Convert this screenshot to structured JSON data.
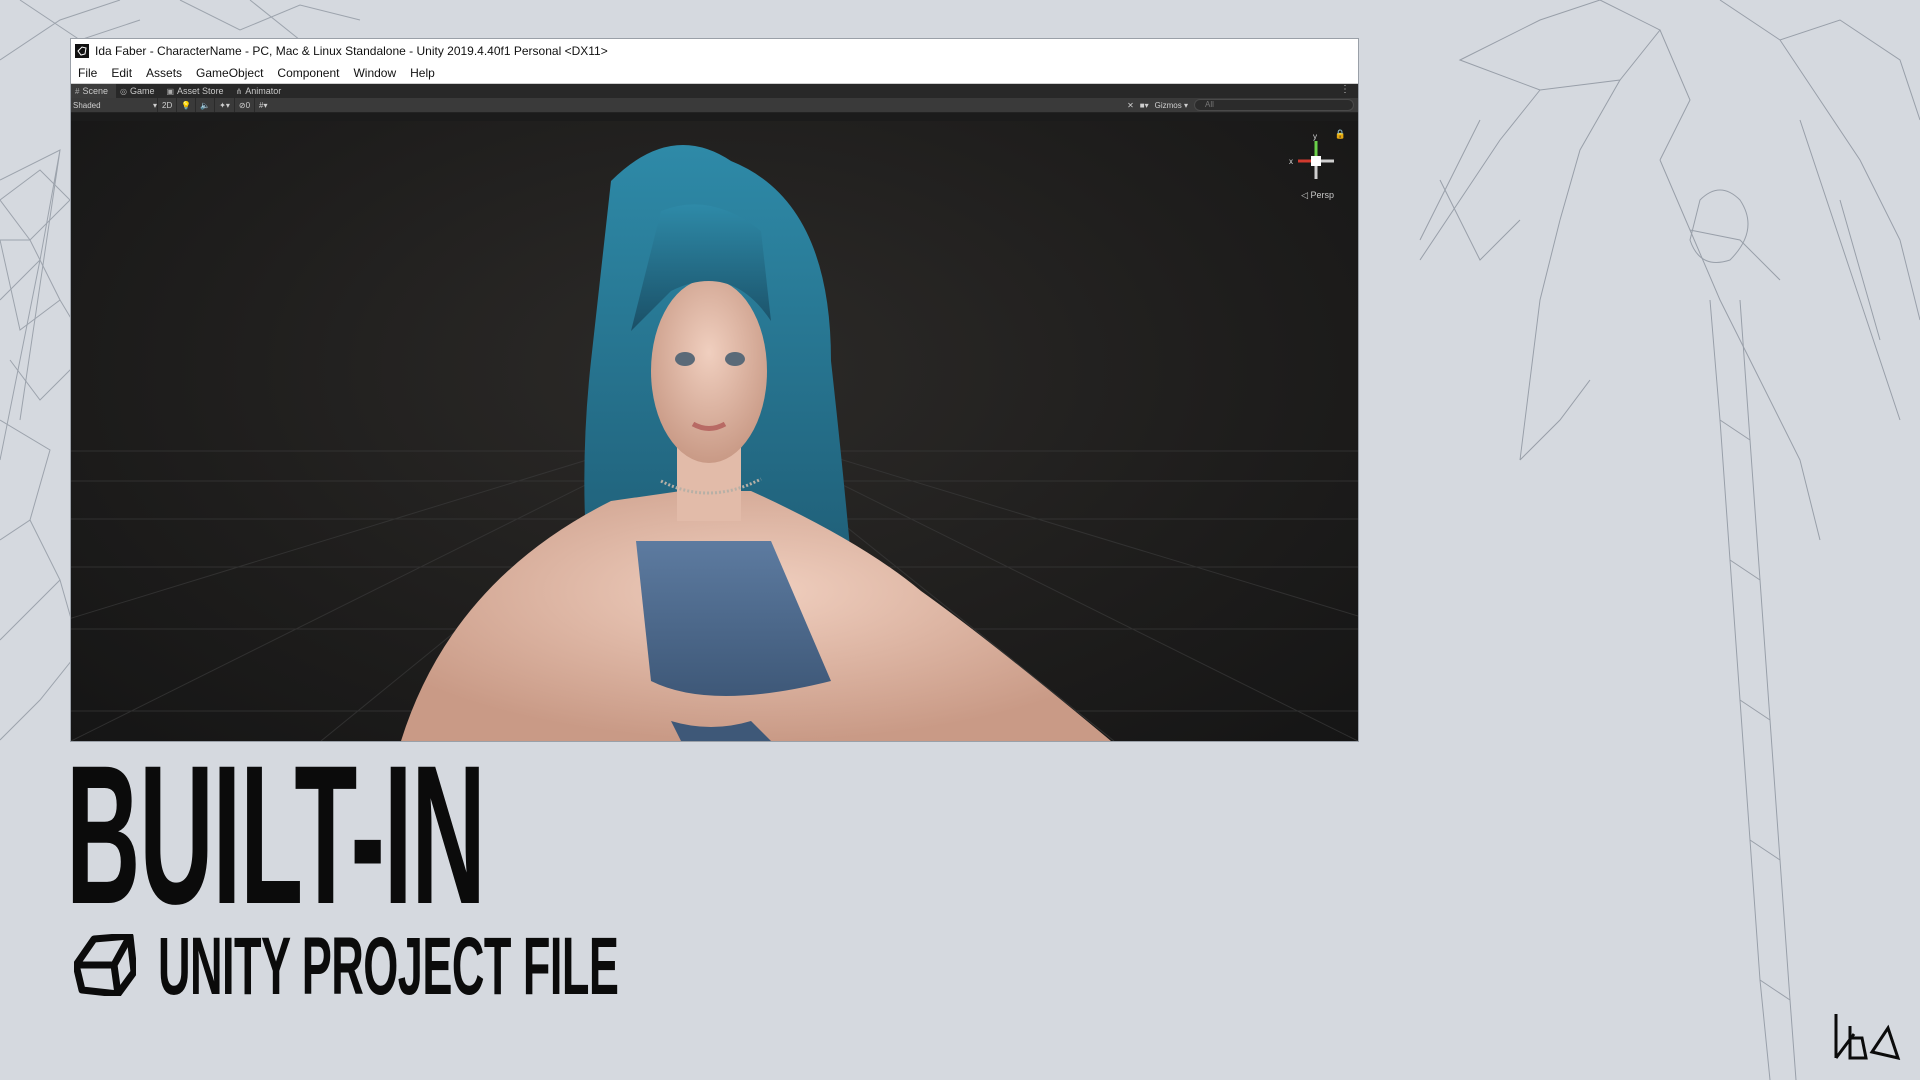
{
  "window": {
    "title": "Ida Faber - CharacterName - PC, Mac & Linux Standalone - Unity 2019.4.40f1 Personal <DX11>",
    "menu": [
      "File",
      "Edit",
      "Assets",
      "GameObject",
      "Component",
      "Window",
      "Help"
    ],
    "tabs": [
      {
        "label": "Scene",
        "icon": "scene-icon"
      },
      {
        "label": "Game",
        "icon": "game-icon"
      },
      {
        "label": "Asset Store",
        "icon": "asset-store-icon"
      },
      {
        "label": "Animator",
        "icon": "animator-icon"
      }
    ],
    "toolbar": {
      "shading_mode": "Shaded",
      "mode_2d": "2D",
      "hidden_count": "0",
      "gizmos_label": "Gizmos",
      "search_placeholder": "All"
    },
    "viewport": {
      "projection_label": "Persp",
      "gizmo_axes": {
        "x": "x",
        "y": "y"
      }
    }
  },
  "headline": "BUILT-IN",
  "subline": "UNITY PROJECT FILE",
  "brand": {
    "accent": "#0b0b0b",
    "background": "#d5d9df"
  }
}
